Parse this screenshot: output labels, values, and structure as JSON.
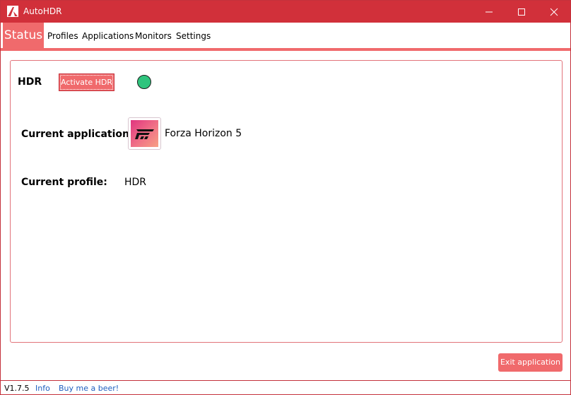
{
  "window": {
    "title": "AutoHDR",
    "accent": "#d1303a",
    "tab_accent": "#f06a6c"
  },
  "tabs": [
    {
      "label": "Status",
      "active": true
    },
    {
      "label": "Profiles",
      "active": false
    },
    {
      "label": "Applications",
      "active": false
    },
    {
      "label": "Monitors",
      "active": false
    },
    {
      "label": "Settings",
      "active": false
    }
  ],
  "status": {
    "hdr_label": "HDR",
    "activate_button": "Activate HDR",
    "hdr_indicator_color": "#2fc47d",
    "current_application_label": "Current application",
    "current_application_name": "Forza Horizon 5",
    "current_application_icon": "forza-horizon-icon",
    "current_profile_label": "Current profile:",
    "current_profile_value": "HDR"
  },
  "footer": {
    "exit_button": "Exit application",
    "version": "V1.7.5",
    "info_link": "Info",
    "beer_link": "Buy me a beer!"
  }
}
